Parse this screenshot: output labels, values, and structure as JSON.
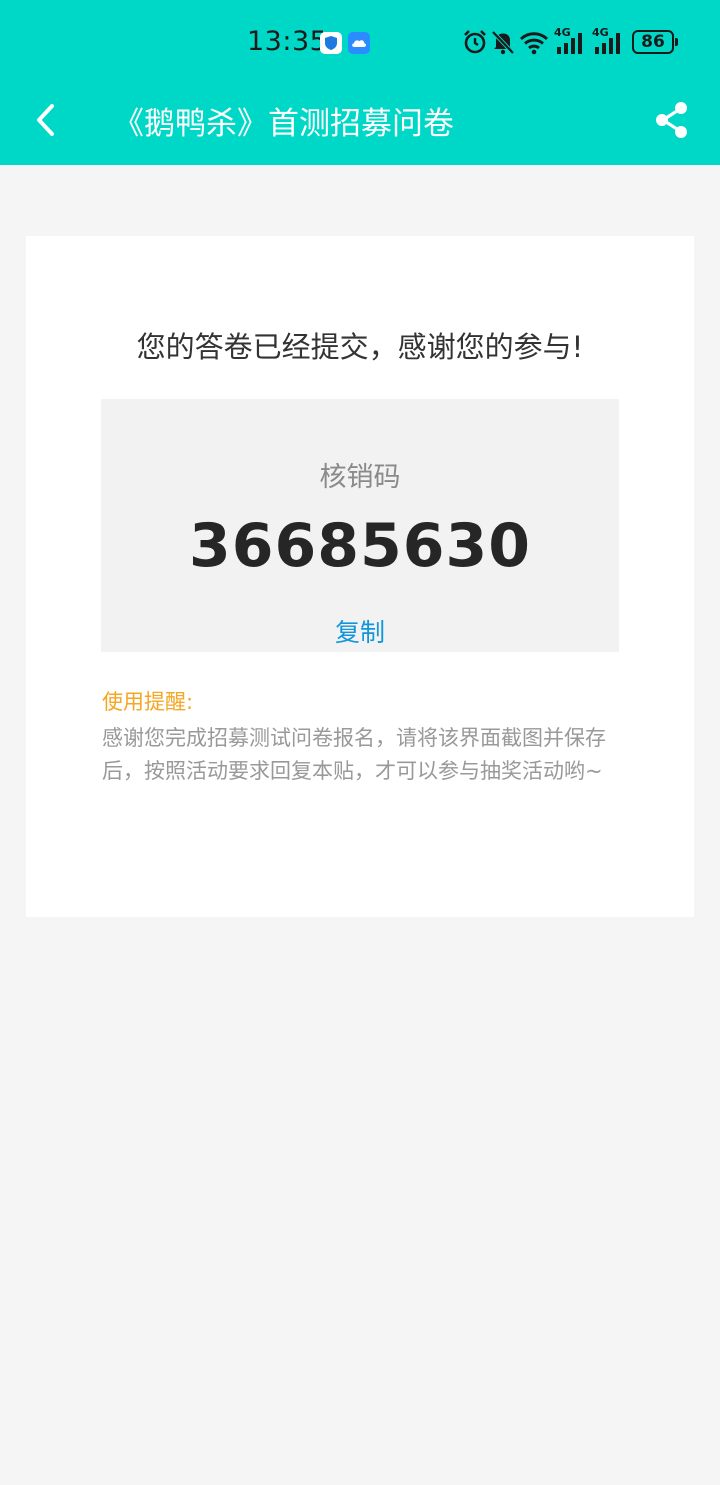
{
  "status_bar": {
    "time": "13:35",
    "battery": "86",
    "signal_label_1": "4G",
    "signal_label_2": "4G"
  },
  "nav": {
    "title": "《鹅鸭杀》首测招募问卷"
  },
  "card": {
    "message": "您的答卷已经提交，感谢您的参与!",
    "code_label": "核销码",
    "code_value": "36685630",
    "copy_label": "复制",
    "reminder_title": "使用提醒:",
    "reminder_body": "感谢您完成招募测试问卷报名，请将该界面截图并保存后，按照活动要求回复本贴，才可以参与抽奖活动哟~"
  },
  "colors": {
    "header": "#00d8c7",
    "accent_link": "#1296db",
    "reminder": "#f5a623",
    "page_bg": "#f5f5f5"
  }
}
